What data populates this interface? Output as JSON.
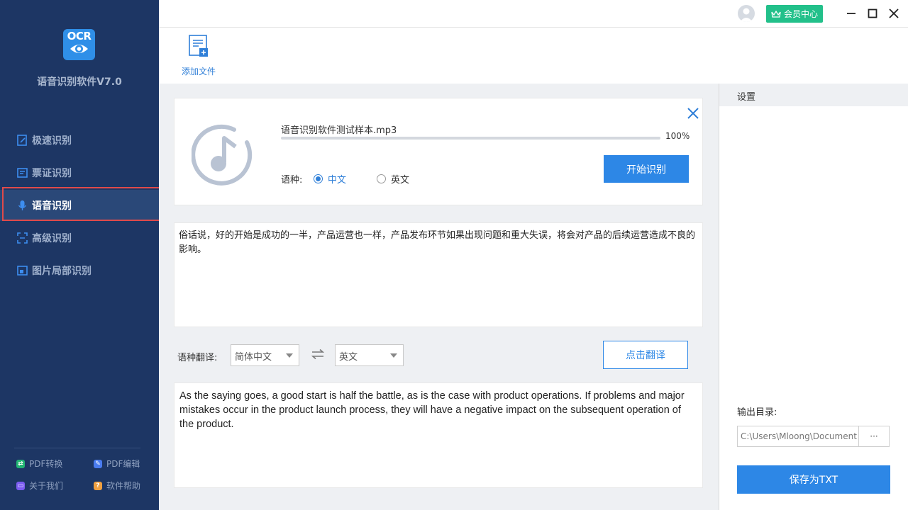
{
  "app": {
    "logo_text": "OCR",
    "title": "语音识别软件V7.0"
  },
  "sidebar": {
    "items": [
      {
        "label": "极速识别",
        "icon": "fast-scan-icon"
      },
      {
        "label": "票证识别",
        "icon": "ticket-icon"
      },
      {
        "label": "语音识别",
        "icon": "microphone-icon",
        "active": true
      },
      {
        "label": "高级识别",
        "icon": "scan-frame-icon"
      },
      {
        "label": "图片局部识别",
        "icon": "image-crop-icon"
      }
    ],
    "footer_links": [
      {
        "label": "PDF转换",
        "icon": "pdf-convert-icon",
        "color": "#22b573"
      },
      {
        "label": "PDF编辑",
        "icon": "pdf-edit-icon",
        "color": "#4a7cf0"
      },
      {
        "label": "关于我们",
        "icon": "about-icon",
        "color": "#7b5cf0"
      },
      {
        "label": "软件帮助",
        "icon": "help-icon",
        "color": "#f0a040"
      }
    ]
  },
  "titlebar": {
    "vip_label": "会员中心"
  },
  "toolbar": {
    "add_file_label": "添加文件"
  },
  "file_card": {
    "file_name": "语音识别软件测试样本.mp3",
    "progress": 1.0,
    "progress_text": "100%",
    "language_label": "语种:",
    "languages": [
      {
        "label": "中文",
        "selected": true
      },
      {
        "label": "英文",
        "selected": false
      }
    ],
    "start_button": "开始识别"
  },
  "recognized_text": "俗话说，好的开始是成功的一半，产品运营也一样，产品发布环节如果出现问题和重大失误，将会对产品的后续运营造成不良的影响。",
  "translation": {
    "label": "语种翻译:",
    "source_lang": "简体中文",
    "target_lang": "英文",
    "button": "点击翻译",
    "result": "As the saying goes, a good start is half the battle, as is the case with product operations. If problems and major mistakes occur in the product launch process, they will have a negative impact on the subsequent operation of the product."
  },
  "settings": {
    "header": "设置",
    "output_label": "输出目录:",
    "output_path": "C:\\Users\\Mloong\\Document",
    "browse_label": "···",
    "save_button": "保存为TXT"
  },
  "colors": {
    "sidebar_bg": "#1d3664",
    "accent": "#2d87e6",
    "vip": "#22c08a",
    "highlight_border": "#e04a4a"
  }
}
